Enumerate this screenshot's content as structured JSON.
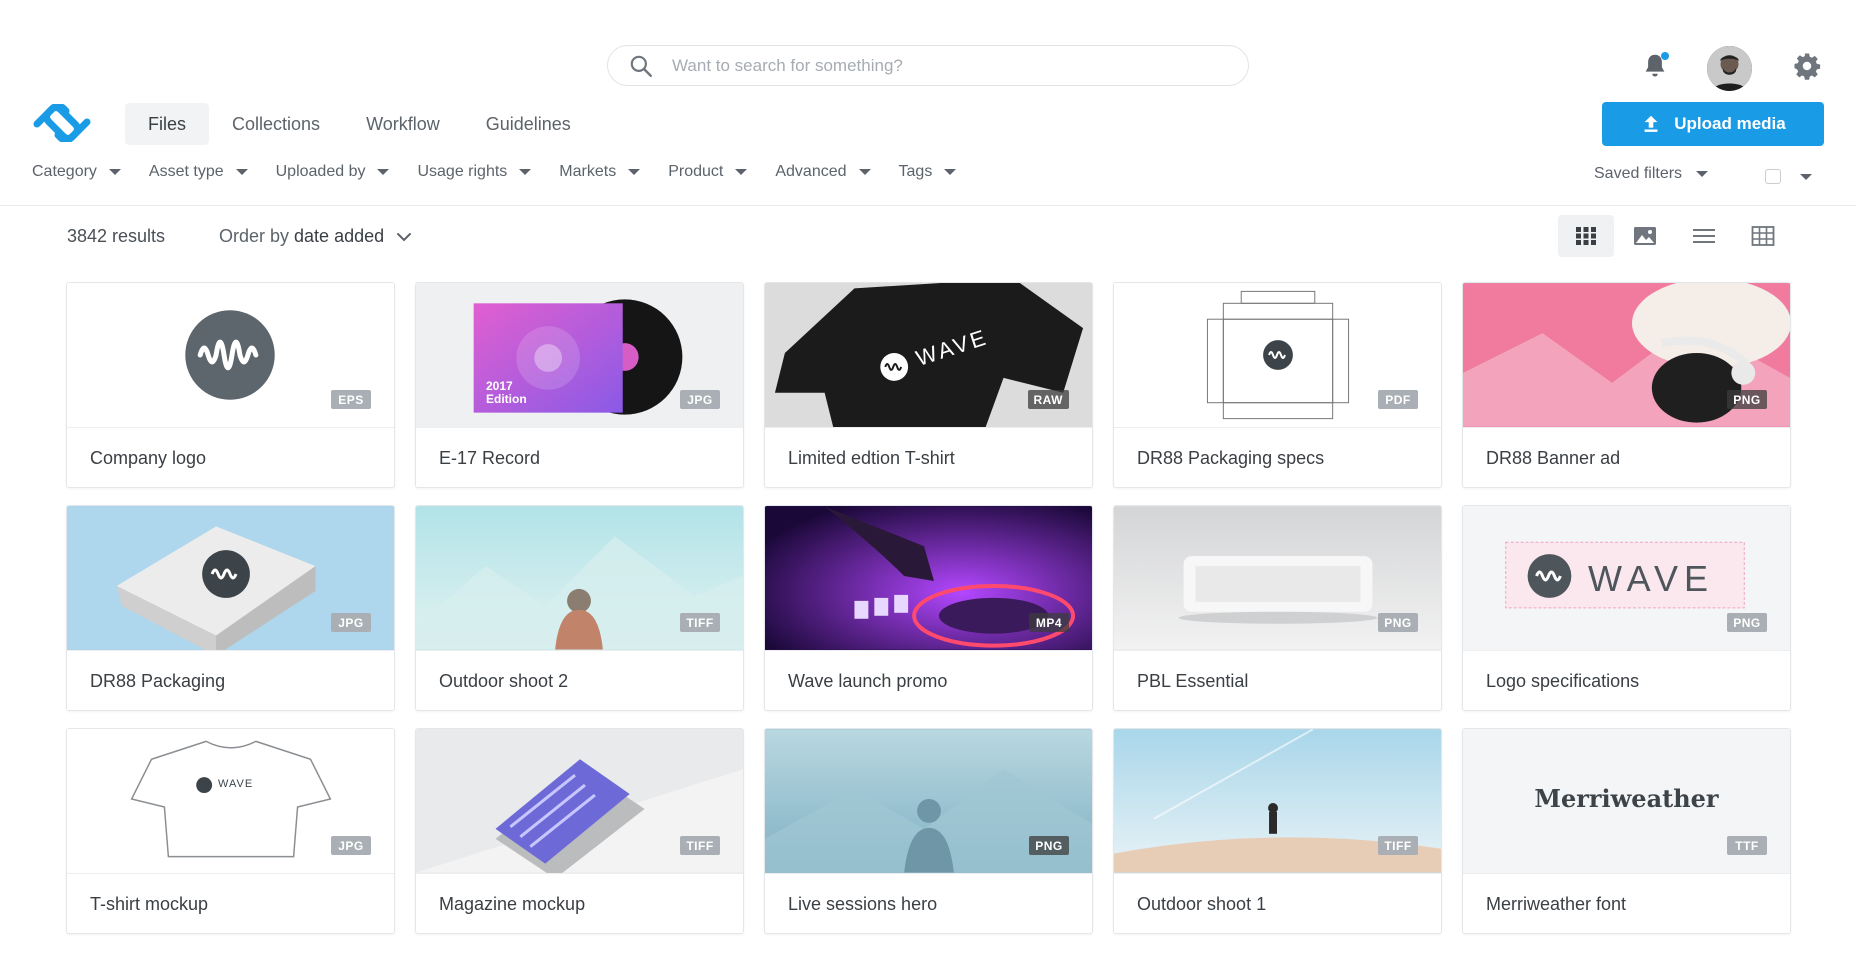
{
  "header": {
    "search_placeholder": "Want to search for something?",
    "nav": [
      {
        "label": "Files",
        "active": true
      },
      {
        "label": "Collections",
        "active": false
      },
      {
        "label": "Workflow",
        "active": false
      },
      {
        "label": "Guidelines",
        "active": false
      }
    ],
    "upload_label": "Upload media",
    "accent_color": "#1a9be6",
    "has_notification": true
  },
  "filters": {
    "items": [
      "Category",
      "Asset type",
      "Uploaded by",
      "Usage rights",
      "Markets",
      "Product",
      "Advanced",
      "Tags"
    ],
    "saved_label": "Saved filters"
  },
  "results": {
    "count_label": "3842 results",
    "order_prefix": "Order by",
    "order_value": "date added",
    "view_modes": [
      "grid-small-icon",
      "image-icon",
      "list-icon",
      "table-icon"
    ],
    "active_view": "grid-small-icon"
  },
  "assets": [
    {
      "title": "Company logo",
      "type": "EPS",
      "art": "logo"
    },
    {
      "title": "E-17 Record",
      "type": "JPG",
      "art": "record",
      "caption": "2017\nEdition"
    },
    {
      "title": "Limited edtion T-shirt",
      "type": "RAW",
      "art": "tshirt-black",
      "print": "WAVE"
    },
    {
      "title": "DR88 Packaging specs",
      "type": "PDF",
      "art": "dieline"
    },
    {
      "title": "DR88 Banner ad",
      "type": "PNG",
      "art": "banner"
    },
    {
      "title": "DR88 Packaging",
      "type": "JPG",
      "art": "box"
    },
    {
      "title": "Outdoor shoot 2",
      "type": "TIFF",
      "art": "outdoor2"
    },
    {
      "title": "Wave launch promo",
      "type": "MP4",
      "art": "dj"
    },
    {
      "title": "PBL Essential",
      "type": "PNG",
      "art": "speaker"
    },
    {
      "title": "Logo specifications",
      "type": "PNG",
      "art": "logospec",
      "wordmark": "WAVE"
    },
    {
      "title": "T-shirt mockup",
      "type": "JPG",
      "art": "tshirt-white",
      "print": "WAVE"
    },
    {
      "title": "Magazine mockup",
      "type": "TIFF",
      "art": "magazine"
    },
    {
      "title": "Live sessions hero",
      "type": "PNG",
      "art": "live"
    },
    {
      "title": "Outdoor shoot 1",
      "type": "TIFF",
      "art": "outdoor1"
    },
    {
      "title": "Merriweather font",
      "type": "TTF",
      "art": "font",
      "specimen": "Merriweather"
    }
  ]
}
